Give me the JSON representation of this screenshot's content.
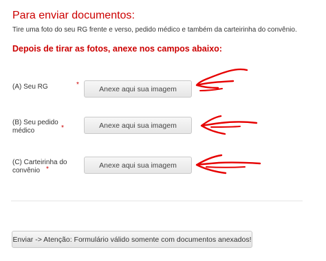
{
  "header": {
    "title": "Para enviar documentos",
    "title_suffix": ":",
    "subtitle": "Tire uma foto do seu RG frente e verso, pedido médico e também da carteirinha do convênio."
  },
  "instruction": "Depois de tirar as fotos, anexe nos campos abaixo:",
  "fields": [
    {
      "label_line1": "(A) Seu RG",
      "label_line2": "",
      "required_mark": "*",
      "button_label": "Anexe aqui sua imagem"
    },
    {
      "label_line1": "(B) Seu pedido",
      "label_line2": "médico",
      "required_mark": "*",
      "button_label": "Anexe aqui sua imagem"
    },
    {
      "label_line1": "(C) Carteirinha do",
      "label_line2": "convênio",
      "required_mark": "*",
      "button_label": "Anexe aqui sua imagem"
    }
  ],
  "submit": {
    "label": "Enviar -> Atenção: Formulário válido somente com documentos anexados!"
  },
  "colors": {
    "accent_red": "#cc0000",
    "annotation_arrow": "#e60000"
  },
  "annotations": {
    "arrow_icon": "hand-drawn-arrow-left-icon"
  }
}
